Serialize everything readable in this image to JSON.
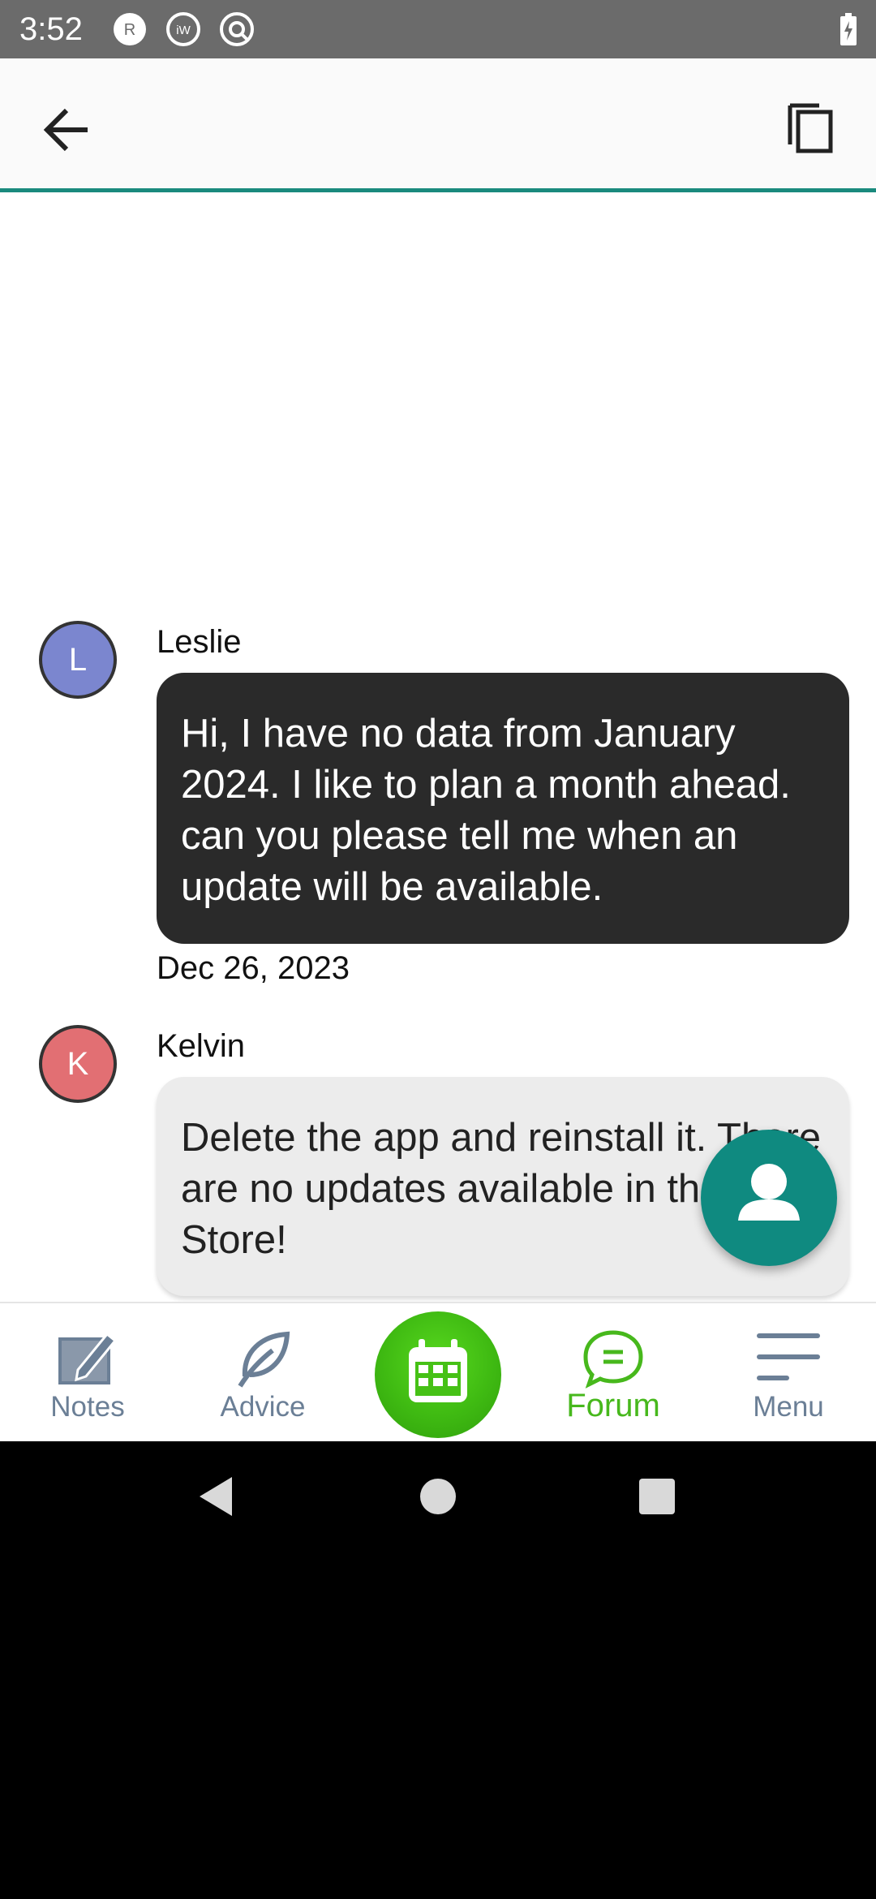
{
  "status_bar": {
    "time": "3:52",
    "icons": [
      "r-notification-icon",
      "iw-notification-icon",
      "at-notification-icon",
      "battery-charging-icon"
    ]
  },
  "app_bar": {
    "back_icon": "arrow-back-icon",
    "copy_icon": "copy-icon",
    "accent_color": "#1a8a7d"
  },
  "thread": {
    "messages": [
      {
        "author": "Leslie",
        "avatar_letter": "L",
        "avatar_color": "#7b86cf",
        "text": "Hi, I have no data from January 2024. I like to plan a month ahead. can you please tell me when an update will be available.",
        "date": "Dec 26, 2023"
      },
      {
        "author": "Kelvin",
        "avatar_letter": "K",
        "avatar_color": "#e26f73",
        "text": "Delete the app and reinstall it. There are no updates available in the App Store!"
      }
    ]
  },
  "fab": {
    "icon": "person-icon",
    "color": "#0f8a80"
  },
  "bottom_nav": {
    "items": [
      {
        "label": "Notes",
        "icon": "notes-pencil-icon"
      },
      {
        "label": "Advice",
        "icon": "leaf-icon"
      },
      {
        "label": "",
        "icon": "calendar-icon"
      },
      {
        "label": "Forum",
        "icon": "chat-bubble-icon",
        "active": true
      },
      {
        "label": "Menu",
        "icon": "hamburger-menu-icon"
      }
    ],
    "active_color": "#47b81c",
    "inactive_color": "#6b7f96"
  },
  "system_nav": {
    "icons": [
      "back-triangle-icon",
      "home-circle-icon",
      "recents-square-icon"
    ]
  }
}
